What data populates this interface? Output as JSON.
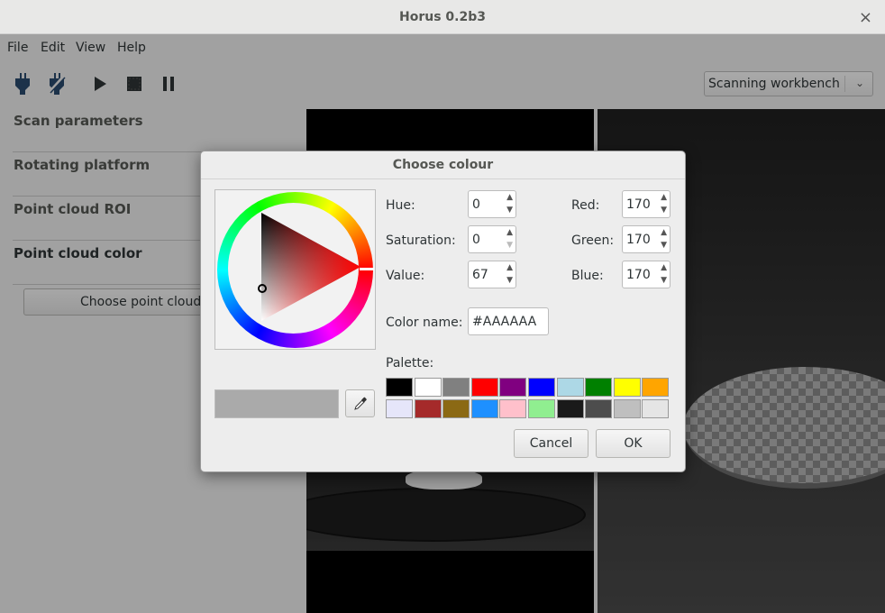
{
  "window": {
    "title": "Horus 0.2b3",
    "close_glyph": "×"
  },
  "menu": [
    "File",
    "Edit",
    "View",
    "Help"
  ],
  "toolbar": {
    "icons": [
      "connect-icon",
      "disconnect-icon",
      "play-icon",
      "stop-icon",
      "pause-icon"
    ],
    "workbench_select": {
      "value": "Scanning workbench"
    }
  },
  "sections": [
    {
      "label": "Scan parameters",
      "active": false
    },
    {
      "label": "Rotating platform",
      "active": false
    },
    {
      "label": "Point cloud ROI",
      "active": false
    },
    {
      "label": "Point cloud color",
      "active": true
    }
  ],
  "choose_button": {
    "label": "Choose point cloud c"
  },
  "dialog": {
    "title": "Choose colour",
    "current_color": "#AAAAAA",
    "hue": {
      "label": "Hue:",
      "value": "0"
    },
    "saturation": {
      "label": "Saturation:",
      "value": "0"
    },
    "value": {
      "label": "Value:",
      "value": "67"
    },
    "red": {
      "label": "Red:",
      "value": "170"
    },
    "green": {
      "label": "Green:",
      "value": "170"
    },
    "blue": {
      "label": "Blue:",
      "value": "170"
    },
    "color_name": {
      "label": "Color name:",
      "value": "#AAAAAA"
    },
    "palette_label": "Palette:",
    "palette_row1": [
      "#000000",
      "#ffffff",
      "#808080",
      "#ff0000",
      "#800080",
      "#0000ff",
      "#add8e6",
      "#008000",
      "#ffff00",
      "#ffa500"
    ],
    "palette_row2": [
      "#e6e6fa",
      "#a52a2a",
      "#8b6914",
      "#1e90ff",
      "#ffc0cb",
      "#90ee90",
      "#1a1a1a",
      "#4d4d4d",
      "#bfbfbf",
      "#e5e5e5"
    ],
    "cancel_label": "Cancel",
    "ok_label": "OK"
  }
}
